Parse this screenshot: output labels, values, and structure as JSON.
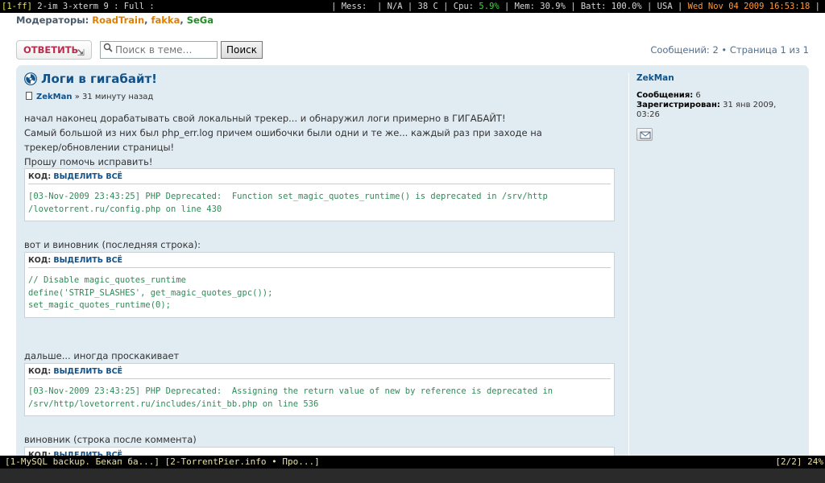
{
  "status_bar": {
    "tag": "[1-ff]",
    "windows": " 2-im 3-xterm 9 : Full :",
    "mess": "| Mess:  | N/A | 38 C | Cpu: ",
    "cpu": "5.9%",
    "mem_label": " | Mem: 30.9% | Batt: 100.0% | USA | ",
    "datetime": "Wed Nov 04 2009 16:53:18",
    "tail": " |"
  },
  "moderators": {
    "label": "Модераторы:",
    "names": [
      "RoadTrain",
      "fakka",
      "SeGa"
    ],
    "colors": [
      "#e07f00",
      "#e07f00",
      "#1e8f1e"
    ]
  },
  "toolbar": {
    "reply_label": "ОТВЕТИТЬ",
    "search_placeholder": "Поиск в теме…",
    "search_button": "Поиск",
    "pagination": "Сообщений: 2 • Страница 1 из 1"
  },
  "post": {
    "title": "Логи в гигабайт!",
    "author": "ZekMan",
    "time": " » 31 минуту назад",
    "paragraph1": [
      "начал наконец дорабатывать свой локальный трекер... и обнаружил логи примерно в ГИГАБАЙТ!",
      "Самый большой из них был php_err.log причем ошибочки были одни и те же... каждый раз при заходе на",
      "трекер/обновлении страницы!",
      "Прошу помочь исправить!"
    ],
    "code_label": "КОД",
    "select_all": "ВЫДЕЛИТЬ ВСЁ",
    "code1": "[03-Nov-2009 23:43:25] PHP Deprecated:  Function set_magic_quotes_runtime() is deprecated in /srv/http\n/lovetorrent.ru/config.php on line 430",
    "text2": "вот и виновник (последняя строка):",
    "code2": "// Disable magic_quotes_runtime\ndefine('STRIP_SLASHES', get_magic_quotes_gpc());\nset_magic_quotes_runtime(0);",
    "text3": "дальше... иногда проскакивает",
    "code3": "[03-Nov-2009 23:43:25] PHP Deprecated:  Assigning the return value of new by reference is deprecated in\n/srv/http/lovetorrent.ru/includes/init_bb.php on line 536",
    "text4": "виновник (строка после коммента)"
  },
  "profile": {
    "name": "ZekMan",
    "posts_label": "Сообщения:",
    "posts_value": " 6",
    "registered_label": "Зарегистрирован:",
    "registered_value": " 31 янв 2009,",
    "registered_time": "03:26"
  },
  "bottom_bar": {
    "tabs": "[1-MySQL backup. Бекап ба...] [2-TorrentPier.info • Про...]",
    "status": "[2/2] 24%"
  }
}
